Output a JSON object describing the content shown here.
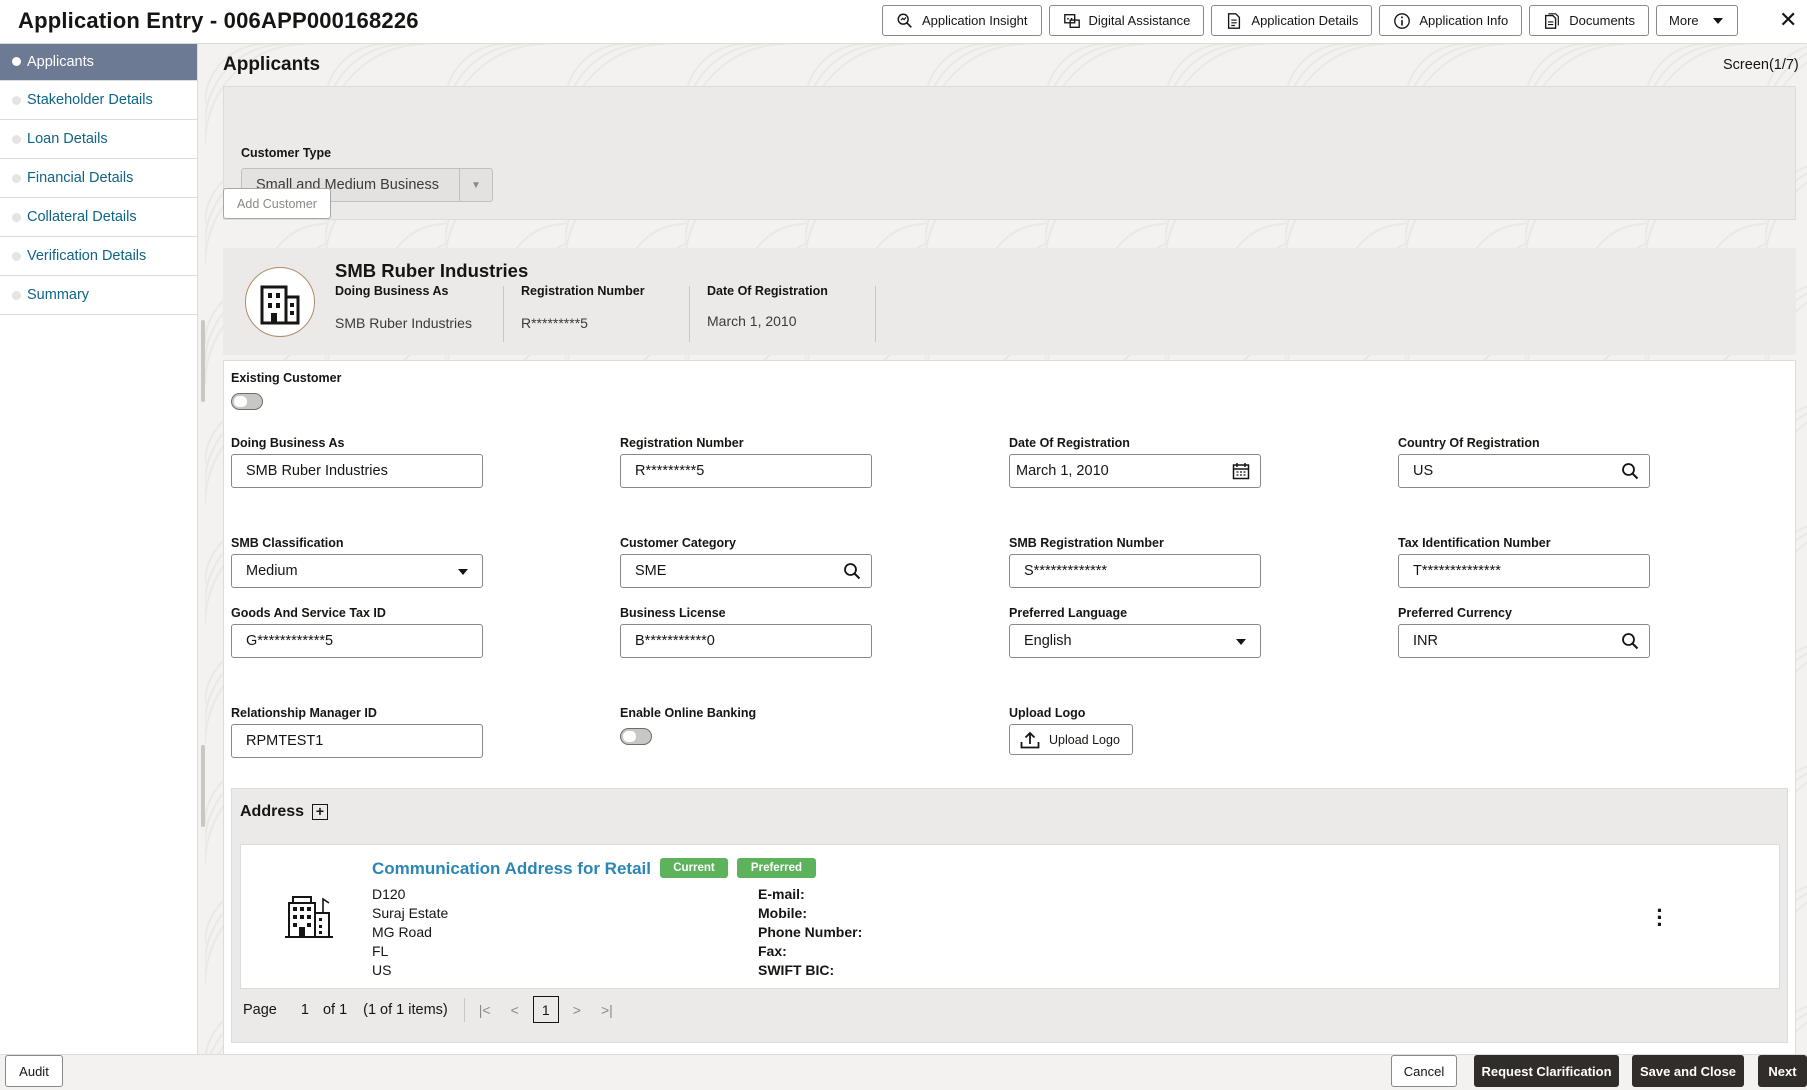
{
  "header": {
    "title": "Application Entry - 006APP000168226",
    "buttons": [
      {
        "label": "Application Insight",
        "icon": "insight-icon"
      },
      {
        "label": "Digital Assistance",
        "icon": "assistant-icon"
      },
      {
        "label": "Application Details",
        "icon": "document-icon"
      },
      {
        "label": "Application Info",
        "icon": "info-icon"
      },
      {
        "label": "Documents",
        "icon": "documents-icon"
      }
    ],
    "more_label": "More",
    "close_glyph": "✕"
  },
  "sidebar": {
    "items": [
      {
        "label": "Applicants",
        "active": true
      },
      {
        "label": "Stakeholder Details"
      },
      {
        "label": "Loan Details"
      },
      {
        "label": "Financial Details"
      },
      {
        "label": "Collateral Details"
      },
      {
        "label": "Verification Details"
      },
      {
        "label": "Summary"
      }
    ]
  },
  "page": {
    "title": "Applicants",
    "screen_indicator": "Screen(1/7)",
    "customer_type_label": "Customer Type",
    "customer_type_value": "Small and Medium Business",
    "add_customer_label": "Add Customer"
  },
  "customer_card": {
    "name": "SMB Ruber Industries",
    "dba_label": "Doing Business As",
    "dba_value": "SMB Ruber Industries",
    "reg_no_label": "Registration Number",
    "reg_no_value": "R*********5",
    "reg_date_label": "Date Of Registration",
    "reg_date_value": "March 1, 2010"
  },
  "form": {
    "existing_customer_label": "Existing Customer",
    "existing_customer_on": false,
    "doing_business_as": {
      "label": "Doing Business As",
      "value": "SMB Ruber Industries"
    },
    "registration_number": {
      "label": "Registration Number",
      "value": "R*********5"
    },
    "date_of_registration": {
      "label": "Date Of Registration",
      "value": "March 1, 2010"
    },
    "country_of_registration": {
      "label": "Country Of Registration",
      "value": "US"
    },
    "smb_classification": {
      "label": "SMB Classification",
      "value": "Medium"
    },
    "customer_category": {
      "label": "Customer Category",
      "value": "SME"
    },
    "smb_registration_number": {
      "label": "SMB Registration Number",
      "value": "S*************"
    },
    "tax_identification_number": {
      "label": "Tax Identification Number",
      "value": "T**************"
    },
    "gst_id": {
      "label": "Goods And Service Tax ID",
      "value": "G************5"
    },
    "business_license": {
      "label": "Business License",
      "value": "B***********0"
    },
    "preferred_language": {
      "label": "Preferred Language",
      "value": "English"
    },
    "preferred_currency": {
      "label": "Preferred Currency",
      "value": "INR"
    },
    "relationship_manager_id": {
      "label": "Relationship Manager ID",
      "value": "RPMTEST1"
    },
    "enable_online_banking": {
      "label": "Enable Online Banking",
      "on": false
    },
    "upload_logo": {
      "label": "Upload Logo",
      "button_label": "Upload Logo"
    }
  },
  "address": {
    "section_title": "Address",
    "add_glyph": "+",
    "card": {
      "title": "Communication Address for Retail",
      "badges": [
        "Current",
        "Preferred"
      ],
      "lines": [
        "D120",
        "Suraj Estate",
        "MG Road",
        "FL",
        "US"
      ],
      "meta_labels": [
        "E-mail:",
        "Mobile:",
        "Phone Number:",
        "Fax:",
        "SWIFT BIC:"
      ]
    },
    "pager": {
      "page_label": "Page",
      "page_value": "1",
      "of_label": "of 1",
      "items_label": "(1 of 1 items)",
      "current": "1"
    }
  },
  "footer": {
    "audit": "Audit",
    "cancel": "Cancel",
    "request_clarification": "Request Clarification",
    "save_and_close": "Save and Close",
    "next": "Next"
  },
  "colors": {
    "accent_link": "#0e6587",
    "sidebar_active": "#6d7a94",
    "badge_green": "#5cb35c",
    "address_title": "#2b86b6",
    "primary_dark": "#312d2a"
  }
}
